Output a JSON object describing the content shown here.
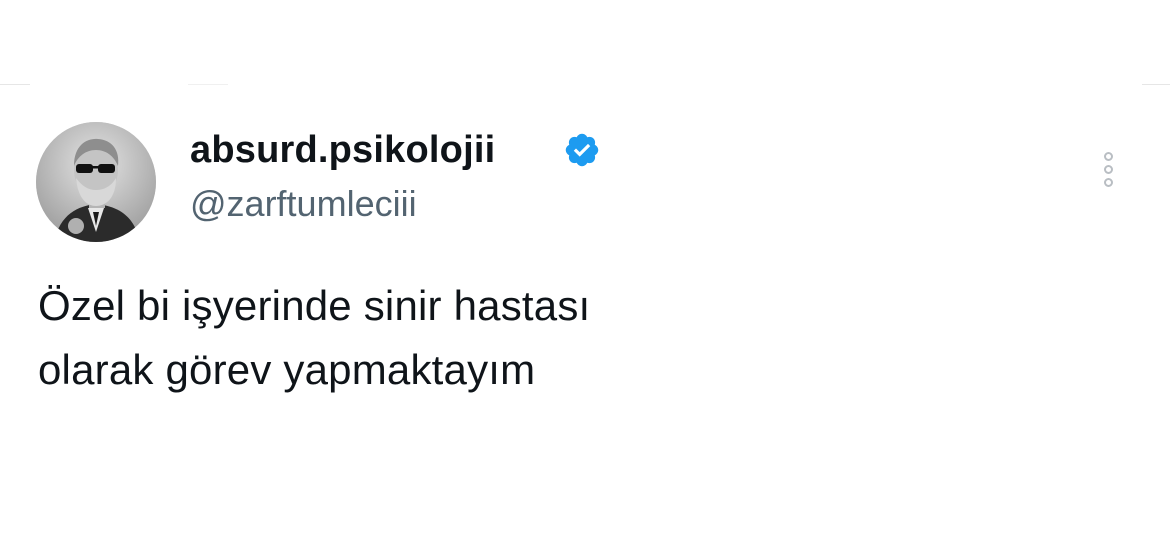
{
  "tweet": {
    "author": {
      "display_name": "absurd.psikolojii",
      "handle": "@zarftumleciii",
      "verified": true,
      "avatar_description": "grayscale portrait with sunglasses"
    },
    "text_lines": [
      "Özel bi işyerinde sinir hastası",
      "olarak görev yapmaktayım"
    ],
    "colors": {
      "verified_badge": "#1d9bf0",
      "text": "#0f1419",
      "handle": "#536471"
    },
    "icons": {
      "verified": "verified-badge-icon",
      "more": "more-options-icon"
    }
  }
}
